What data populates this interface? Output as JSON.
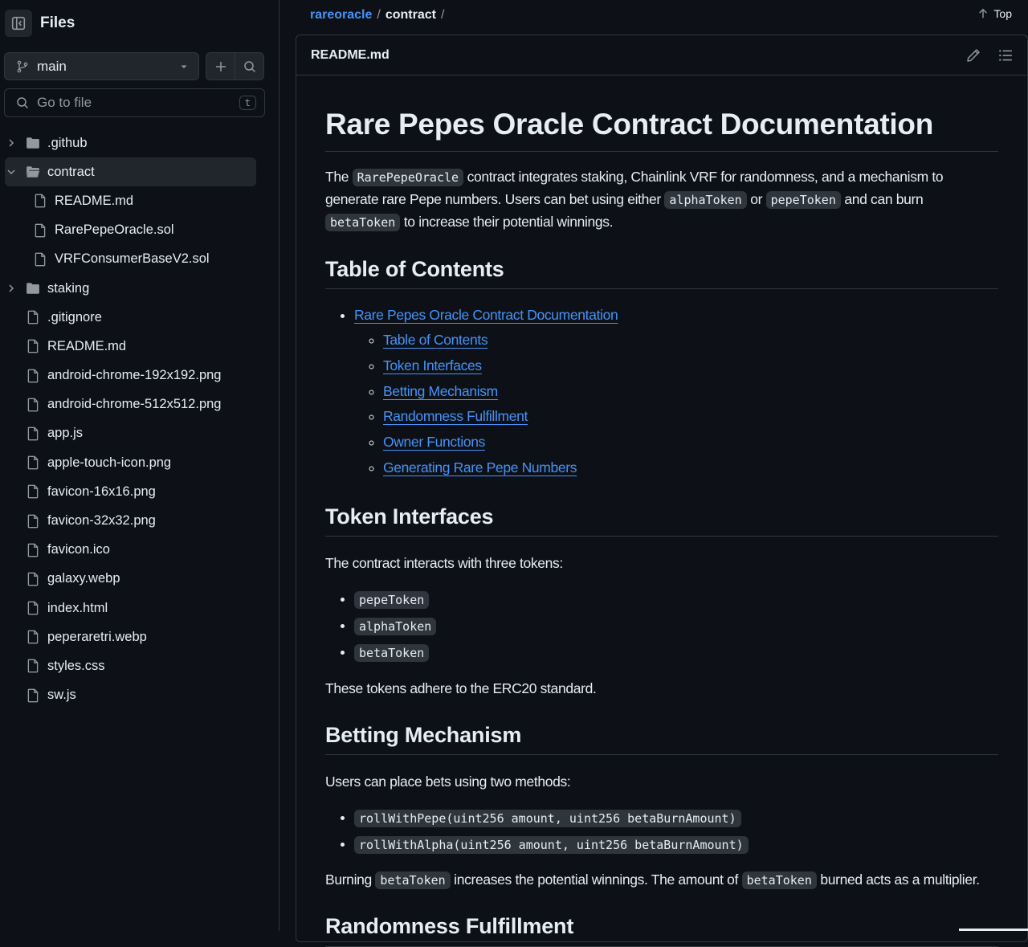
{
  "sidebar": {
    "title": "Files",
    "branch": "main",
    "goto_placeholder": "Go to file",
    "goto_shortcut": "t",
    "tree": [
      {
        "name": ".github",
        "type": "folder",
        "expanded": false,
        "depth": 0
      },
      {
        "name": "contract",
        "type": "folder",
        "expanded": true,
        "depth": 0,
        "active": true
      },
      {
        "name": "README.md",
        "type": "file",
        "depth": 1
      },
      {
        "name": "RarePepeOracle.sol",
        "type": "file",
        "depth": 1
      },
      {
        "name": "VRFConsumerBaseV2.sol",
        "type": "file",
        "depth": 1
      },
      {
        "name": "staking",
        "type": "folder",
        "expanded": false,
        "depth": 0
      },
      {
        "name": ".gitignore",
        "type": "file",
        "depth": 0
      },
      {
        "name": "README.md",
        "type": "file",
        "depth": 0
      },
      {
        "name": "android-chrome-192x192.png",
        "type": "file",
        "depth": 0
      },
      {
        "name": "android-chrome-512x512.png",
        "type": "file",
        "depth": 0
      },
      {
        "name": "app.js",
        "type": "file",
        "depth": 0
      },
      {
        "name": "apple-touch-icon.png",
        "type": "file",
        "depth": 0
      },
      {
        "name": "favicon-16x16.png",
        "type": "file",
        "depth": 0
      },
      {
        "name": "favicon-32x32.png",
        "type": "file",
        "depth": 0
      },
      {
        "name": "favicon.ico",
        "type": "file",
        "depth": 0
      },
      {
        "name": "galaxy.webp",
        "type": "file",
        "depth": 0
      },
      {
        "name": "index.html",
        "type": "file",
        "depth": 0
      },
      {
        "name": "peperaretri.webp",
        "type": "file",
        "depth": 0
      },
      {
        "name": "styles.css",
        "type": "file",
        "depth": 0
      },
      {
        "name": "sw.js",
        "type": "file",
        "depth": 0
      }
    ]
  },
  "breadcrumb": {
    "repo": "rareoracle",
    "sep": "/",
    "folder": "contract",
    "trailing": "/",
    "top_label": "Top"
  },
  "file": {
    "name": "README.md"
  },
  "doc": {
    "h1": "Rare Pepes Oracle Contract Documentation",
    "intro": {
      "t1": "The ",
      "c1": "RarePepeOracle",
      "t2": " contract integrates staking, Chainlink VRF for randomness, and a mechanism to generate rare Pepe numbers. Users can bet using either ",
      "c2": "alphaToken",
      "t3": " or ",
      "c3": "pepeToken",
      "t4": " and can burn ",
      "c4": "betaToken",
      "t5": " to increase their potential winnings."
    },
    "toc_heading": "Table of Contents",
    "toc_root": "Rare Pepes Oracle Contract Documentation",
    "toc_items": [
      "Table of Contents",
      "Token Interfaces",
      "Betting Mechanism",
      "Randomness Fulfillment",
      "Owner Functions",
      "Generating Rare Pepe Numbers"
    ],
    "tokens_heading": "Token Interfaces",
    "tokens_intro": "The contract interacts with three tokens:",
    "tokens": [
      "pepeToken",
      "alphaToken",
      "betaToken"
    ],
    "tokens_note": "These tokens adhere to the ERC20 standard.",
    "betting_heading": "Betting Mechanism",
    "betting_intro": "Users can place bets using two methods:",
    "methods": [
      "rollWithPepe(uint256 amount, uint256 betaBurnAmount)",
      "rollWithAlpha(uint256 amount, uint256 betaBurnAmount)"
    ],
    "burn": {
      "t1": "Burning ",
      "c1": "betaToken",
      "t2": " increases the potential winnings. The amount of ",
      "c2": "betaToken",
      "t3": " burned acts as a multiplier."
    },
    "random_heading": "Randomness Fulfillment"
  },
  "colors": {
    "bg": "#0d1117",
    "border": "#30363d",
    "link": "#4493f8",
    "text": "#e6edf3",
    "muted": "#9198a1"
  }
}
